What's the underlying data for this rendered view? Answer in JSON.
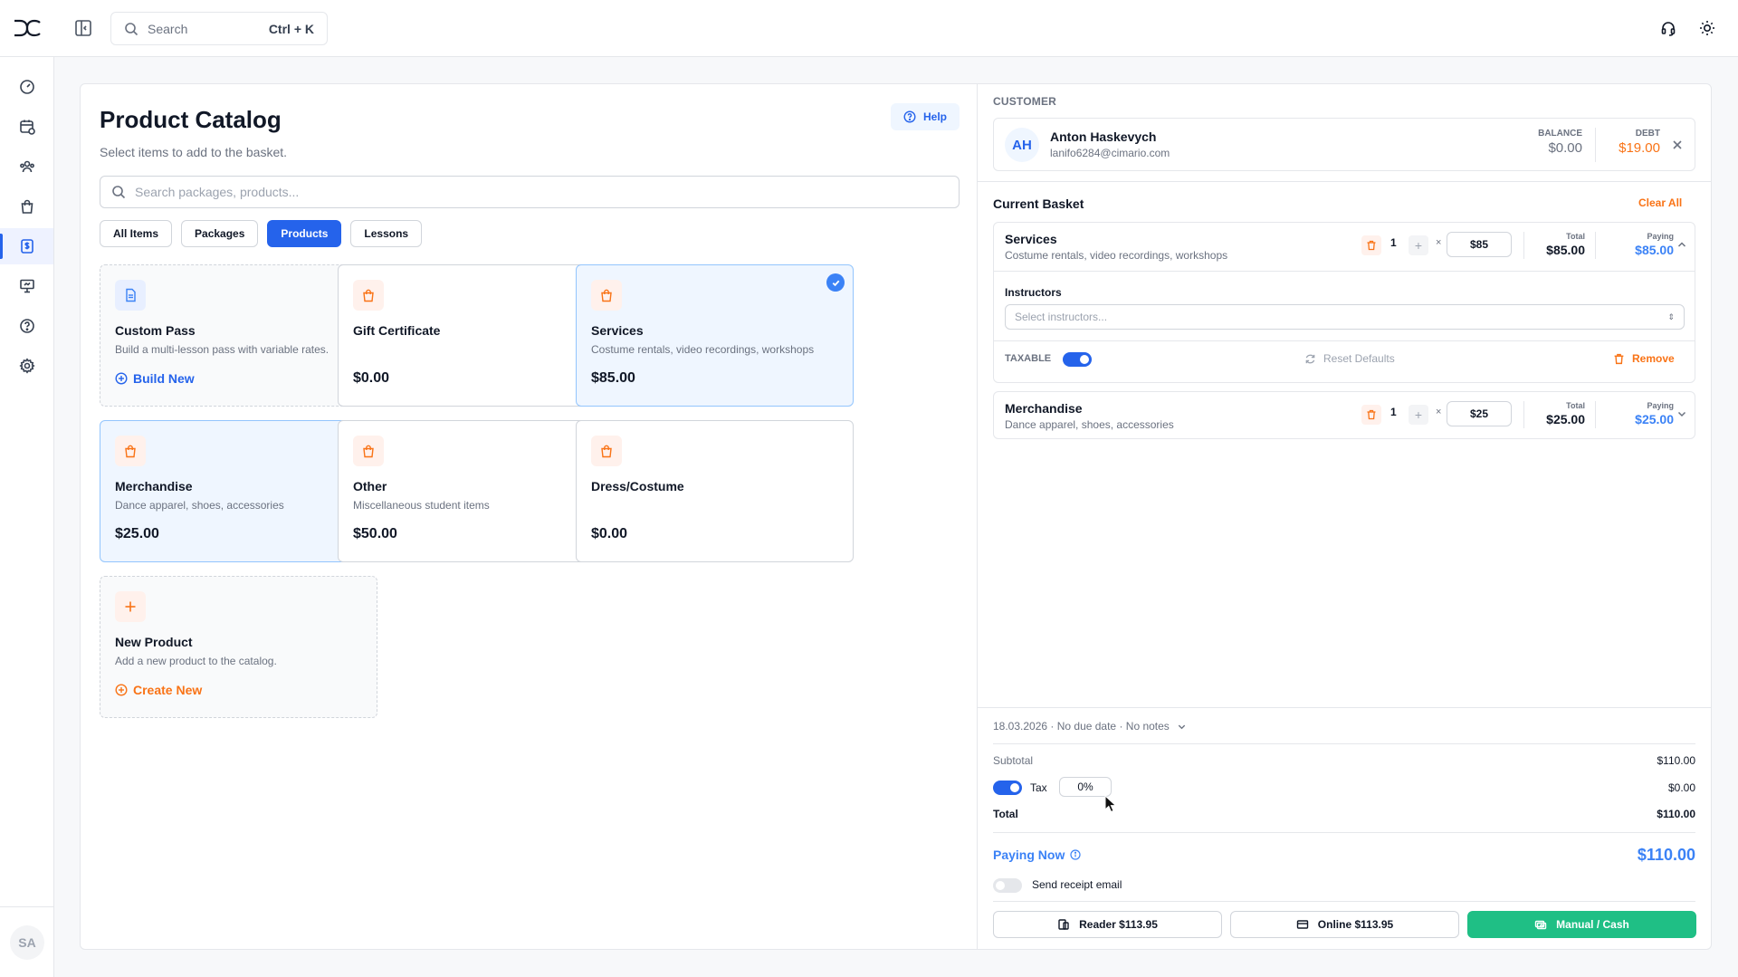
{
  "topbar": {
    "search_placeholder": "Search",
    "search_shortcut": "Ctrl + K"
  },
  "sidebar": {
    "items": [
      {
        "icon": "dashboard-icon"
      },
      {
        "icon": "calendar-icon"
      },
      {
        "icon": "users-icon"
      },
      {
        "icon": "shopping-bag-icon"
      },
      {
        "icon": "billing-icon",
        "active": true
      },
      {
        "icon": "presentation-icon"
      },
      {
        "icon": "help-icon"
      },
      {
        "icon": "settings-icon"
      }
    ],
    "user_initials": "SA"
  },
  "catalog": {
    "title": "Product Catalog",
    "subtitle": "Select items to add to the basket.",
    "help_label": "Help",
    "search_placeholder": "Search packages, products...",
    "filters": [
      "All Items",
      "Packages",
      "Products",
      "Lessons"
    ],
    "active_filter": "Products",
    "cards": [
      {
        "name": "Custom Pass",
        "desc": "Build a multi-lesson pass with variable rates.",
        "link": "Build New"
      },
      {
        "name": "Gift Certificate",
        "desc": "",
        "price": "$0.00"
      },
      {
        "name": "Services",
        "desc": "Costume rentals, video recordings, workshops",
        "price": "$85.00",
        "selected": true
      },
      {
        "name": "Merchandise",
        "desc": "Dance apparel, shoes, accessories",
        "price": "$25.00",
        "selected": true
      },
      {
        "name": "Other",
        "desc": "Miscellaneous student items",
        "price": "$50.00"
      },
      {
        "name": "Dress/Costume",
        "desc": "",
        "price": "$0.00"
      },
      {
        "name": "New Product",
        "desc": "Add a new product to the catalog.",
        "link": "Create New"
      }
    ]
  },
  "customer": {
    "section_label": "CUSTOMER",
    "initials": "AH",
    "name": "Anton Haskevych",
    "email": "lanifo6284@cimario.com",
    "balance_label": "BALANCE",
    "balance": "$0.00",
    "debt_label": "DEBT",
    "debt": "$19.00"
  },
  "basket": {
    "title": "Current Basket",
    "clear_all": "Clear All",
    "items": [
      {
        "name": "Services",
        "desc": "Costume rentals, video recordings, workshops",
        "qty": "1",
        "times": "×",
        "rate": "$85",
        "total_label": "Total",
        "total": "$85.00",
        "paying_label": "Paying",
        "paying": "$85.00",
        "expanded": true,
        "instructors_label": "Instructors",
        "instructors_placeholder": "Select instructors...",
        "taxable_label": "TAXABLE",
        "taxable": true,
        "reset_label": "Reset Defaults",
        "remove_label": "Remove"
      },
      {
        "name": "Merchandise",
        "desc": "Dance apparel, shoes, accessories",
        "qty": "1",
        "times": "×",
        "rate": "$25",
        "total_label": "Total",
        "total": "$25.00",
        "paying_label": "Paying",
        "paying": "$25.00",
        "expanded": false
      }
    ]
  },
  "summary": {
    "meta": "18.03.2026 · No due date · No notes",
    "subtotal_label": "Subtotal",
    "subtotal": "$110.00",
    "tax_label": "Tax",
    "tax_rate": "0%",
    "tax": "$0.00",
    "total_label": "Total",
    "total": "$110.00",
    "paying_now_label": "Paying Now",
    "paying_now": "$110.00",
    "receipt_label": "Send receipt email",
    "send_receipt": false
  },
  "payment": {
    "reader_label": "Reader $113.95",
    "online_label": "Online $113.95",
    "cash_label": "Manual / Cash"
  },
  "colors": {
    "primary": "#2563eb",
    "accent_orange": "#f97316",
    "success": "#1fbf85"
  }
}
